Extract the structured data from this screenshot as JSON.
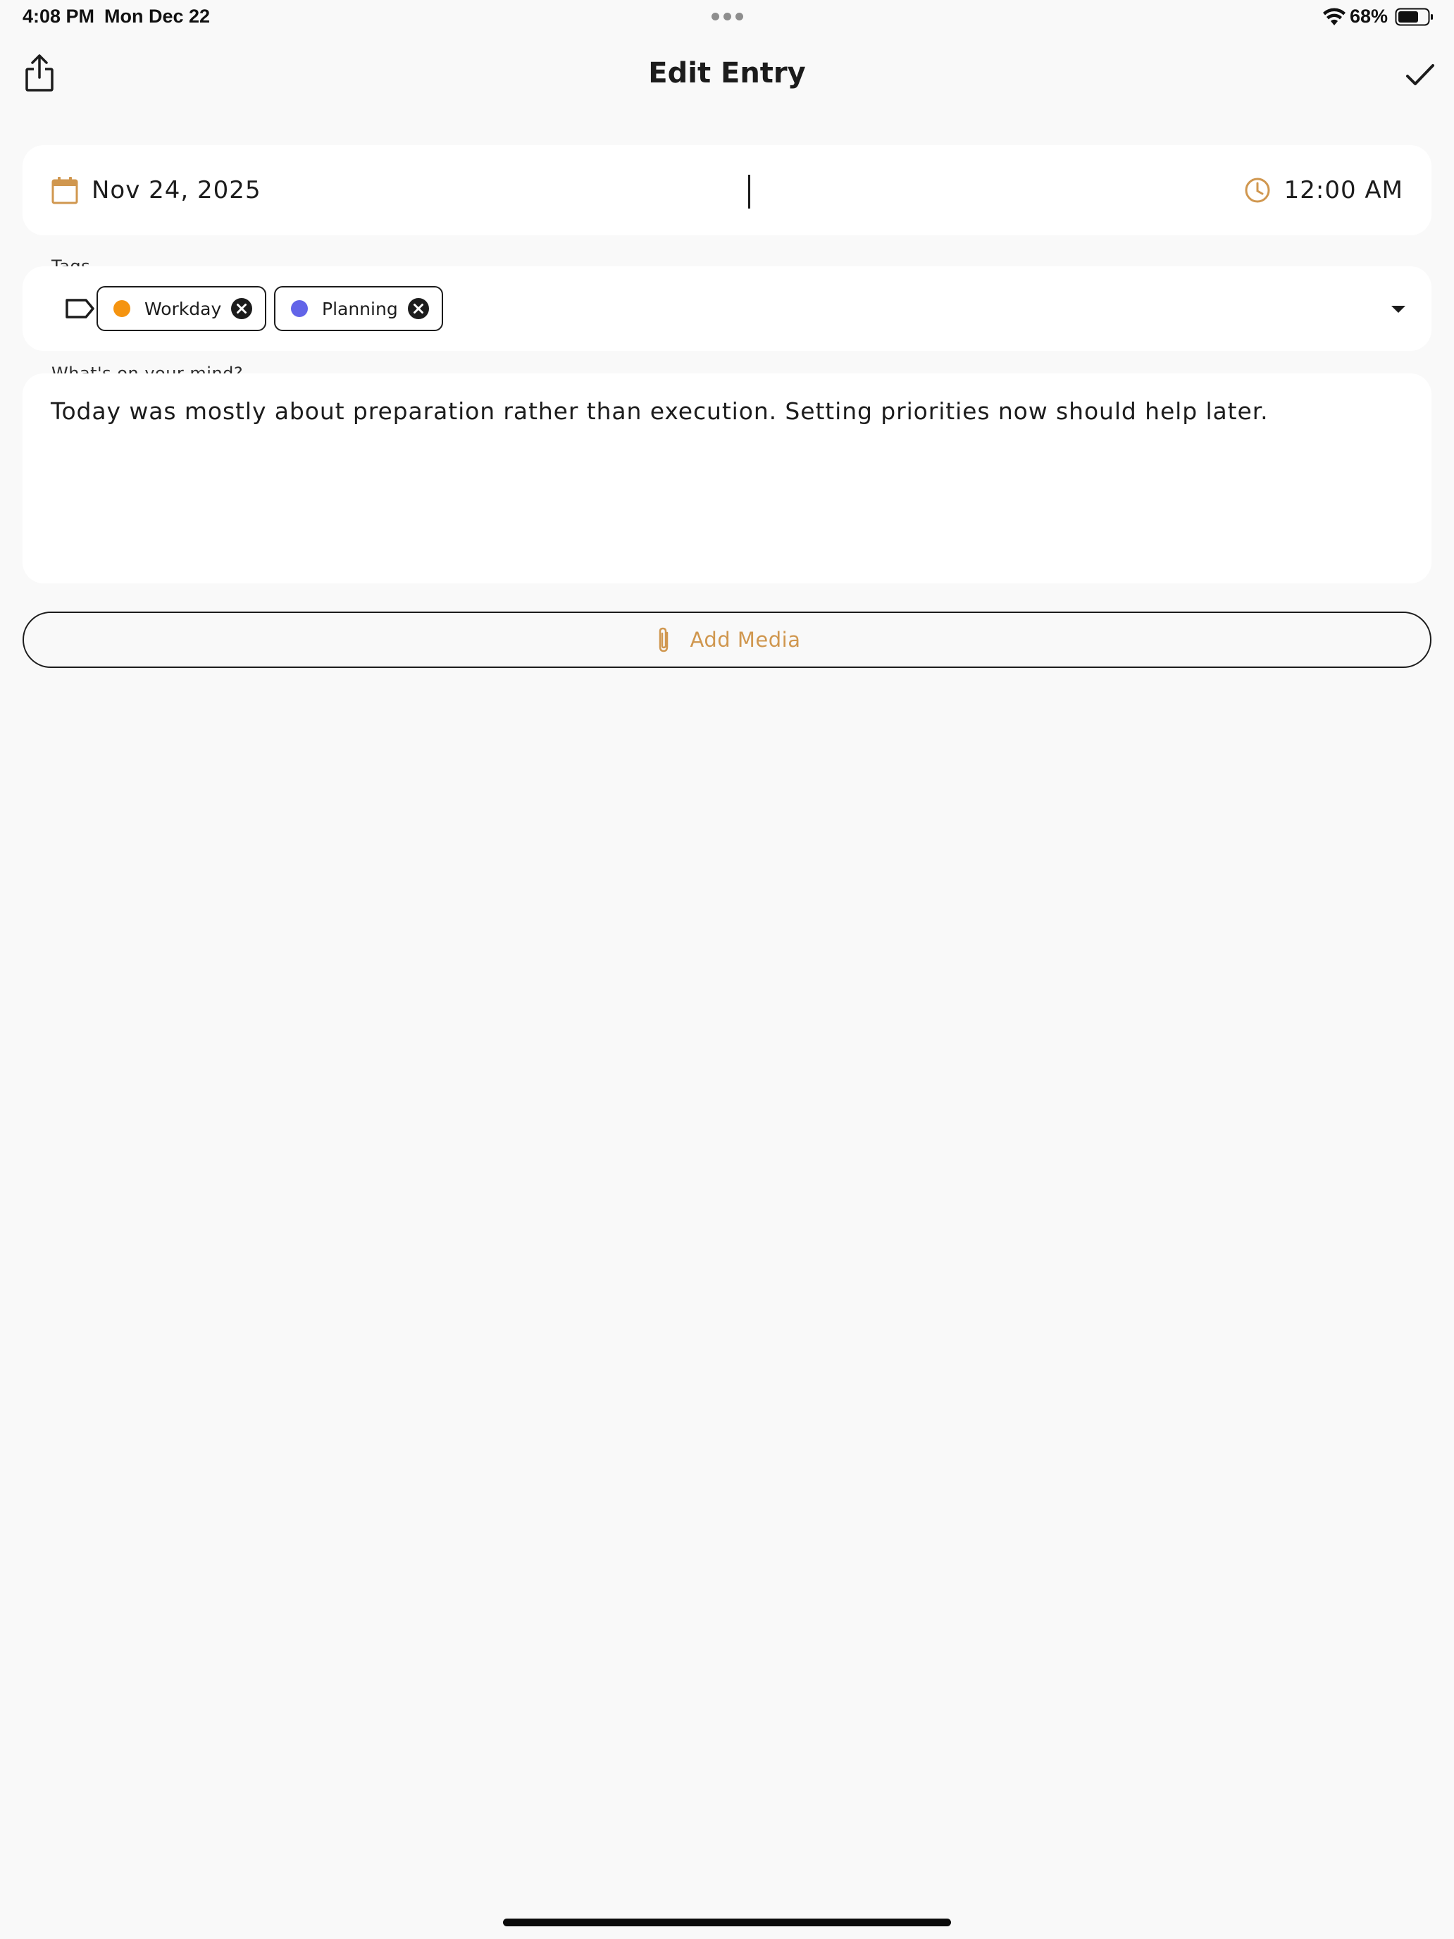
{
  "status_bar": {
    "time": "4:08 PM",
    "date": "Mon Dec 22",
    "battery": "68%"
  },
  "nav": {
    "title": "Edit Entry",
    "share_icon": "share-icon",
    "done_icon": "checkmark-icon"
  },
  "entry": {
    "date": "Nov 24, 2025",
    "time": "12:00 AM"
  },
  "tags": {
    "label": "Tags",
    "items": [
      {
        "label": "Workday",
        "color": "#f59410"
      },
      {
        "label": "Planning",
        "color": "#6264e8"
      }
    ]
  },
  "mind": {
    "label": "What's on your mind?",
    "text": "Today was mostly about preparation rather than execution. Setting priorities now should help later."
  },
  "media": {
    "label": "Add Media"
  },
  "colors": {
    "accent": "#d0974f",
    "background": "#f9f9f9",
    "card": "#ffffff"
  }
}
